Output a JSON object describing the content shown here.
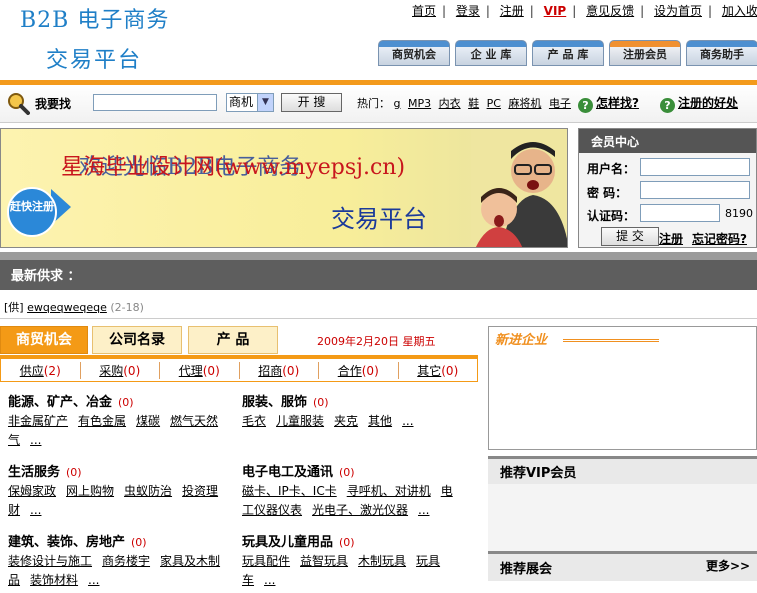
{
  "header": {
    "site_name_line1": "B2B 电子商务",
    "site_name_line2": "交易平台",
    "top_links": [
      "首页",
      "登录",
      "注册",
      "VIP",
      "意见反馈",
      "设为首页",
      "加入收藏"
    ],
    "nav_tabs": [
      "商贸机会",
      "企 业 库",
      "产 品 库",
      "注册会员",
      "商务助手"
    ]
  },
  "search": {
    "label": "我要找",
    "input_value": "",
    "select_value": "商机",
    "button_label": "开 搜",
    "hot_label": "热门：",
    "hot_items": [
      "g",
      "MP3",
      "内衣",
      "鞋",
      "PC",
      "麻将机",
      "电子"
    ],
    "how_find": "怎样找?",
    "why_register": "注册的好处"
  },
  "banner": {
    "text_overlay_red": "星海毕业设计网(www.myepsj.cn)",
    "text_welcome": "欢迎光临B2B电子商务",
    "text_platform": "交易平台",
    "badge": "赶快注册"
  },
  "member": {
    "title": "会员中心",
    "username_label": "用户名：",
    "password_label": "密  码：",
    "captcha_label": "认证码：",
    "captcha_code": "8190",
    "submit_label": "提 交",
    "register_link": "注册",
    "forgot_link": "忘记密码?"
  },
  "supply": {
    "title": "最新供求  ：",
    "item_type": "[供]",
    "item_title": "ewqeqweqeqe",
    "item_date": "(2-18)"
  },
  "tabs": {
    "items": [
      "商贸机会",
      "公司名录",
      "产  品"
    ],
    "date": "2009年2月20日 星期五"
  },
  "subtabs": [
    {
      "label": "供应",
      "count": "(2)"
    },
    {
      "label": "采购",
      "count": "(0)"
    },
    {
      "label": "代理",
      "count": "(0)"
    },
    {
      "label": "招商",
      "count": "(0)"
    },
    {
      "label": "合作",
      "count": "(0)"
    },
    {
      "label": "其它",
      "count": "(0)"
    }
  ],
  "categories": [
    {
      "title": "能源、矿产、冶金",
      "count": "(0)",
      "links": [
        "非金属矿产",
        "有色金属",
        "煤碳",
        "燃气天然气",
        "..."
      ]
    },
    {
      "title": "服装、服饰",
      "count": "(0)",
      "links": [
        "毛衣",
        "儿童服装",
        "夹克",
        "其他",
        "..."
      ]
    },
    {
      "title": "生活服务",
      "count": "(0)",
      "links": [
        "保姆家政",
        "网上购物",
        "虫蚁防治",
        "投资理财",
        "..."
      ]
    },
    {
      "title": "电子电工及通讯",
      "count": "(0)",
      "links": [
        "磁卡、IP卡、IC卡",
        "寻呼机、对讲机",
        "电工仪器仪表",
        "光电子、激光仪器",
        "..."
      ]
    },
    {
      "title": "建筑、装饰、房地产",
      "count": "(0)",
      "links": [
        "装修设计与施工",
        "商务楼宇",
        "家具及木制品",
        "装饰材料",
        "..."
      ]
    },
    {
      "title": "玩具及儿童用品",
      "count": "(0)",
      "links": [
        "玩具配件",
        "益智玩具",
        "木制玩具",
        "玩具车",
        "..."
      ]
    }
  ],
  "right": {
    "new_corp": "新进企业",
    "vip_title": "推荐VIP会员",
    "expo_title": "推荐展会",
    "expo_more": "更多>>"
  },
  "colors": {
    "accent": "#f49a16",
    "brand_blue": "#1f7fc7",
    "dark_bar": "#5e5e5e",
    "count_red": "#cc0000"
  }
}
